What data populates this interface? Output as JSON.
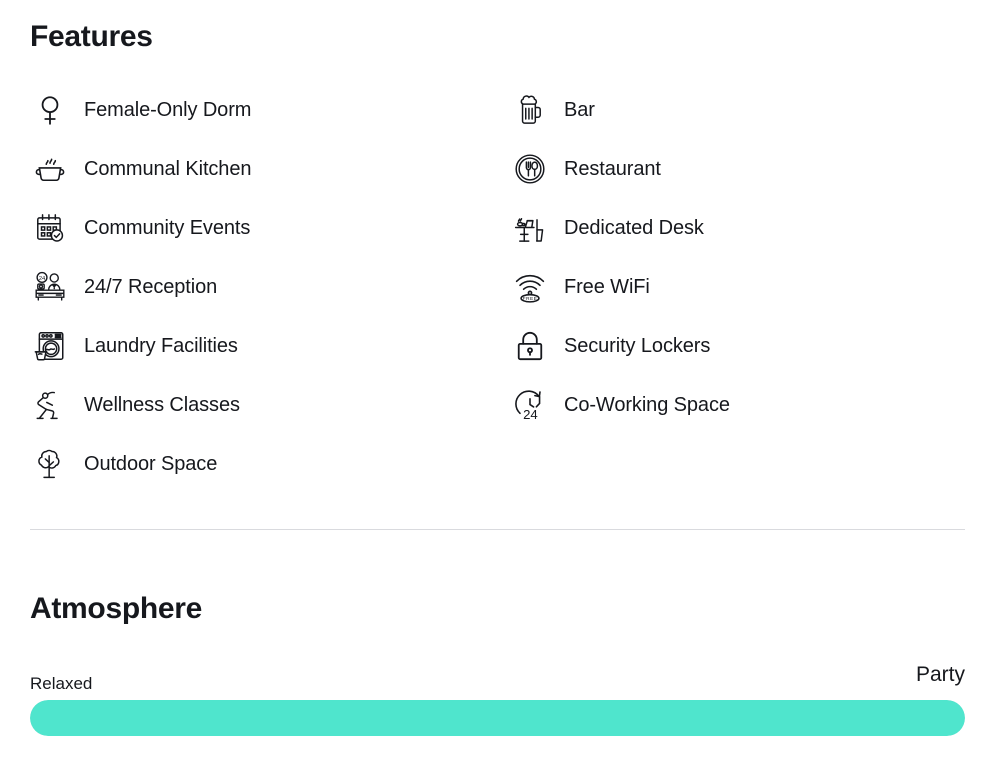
{
  "features": {
    "title": "Features",
    "items": [
      {
        "label": "Female-Only Dorm",
        "icon": "female-symbol-icon",
        "column": "left"
      },
      {
        "label": "Communal Kitchen",
        "icon": "cooking-pot-icon",
        "column": "left"
      },
      {
        "label": "Community Events",
        "icon": "calendar-check-icon",
        "column": "left"
      },
      {
        "label": "24/7 Reception",
        "icon": "reception-desk-icon",
        "column": "left"
      },
      {
        "label": "Laundry Facilities",
        "icon": "washing-machine-icon",
        "column": "left"
      },
      {
        "label": "Wellness Classes",
        "icon": "yoga-pose-icon",
        "column": "left"
      },
      {
        "label": "Outdoor Space",
        "icon": "tree-icon",
        "column": "left"
      },
      {
        "label": "Bar",
        "icon": "beer-mug-icon",
        "column": "right"
      },
      {
        "label": "Restaurant",
        "icon": "plate-cutlery-icon",
        "column": "right"
      },
      {
        "label": "Dedicated Desk",
        "icon": "desk-laptop-icon",
        "column": "right"
      },
      {
        "label": "Free WiFi",
        "icon": "wifi-free-icon",
        "column": "right"
      },
      {
        "label": "Security Lockers",
        "icon": "padlock-icon",
        "column": "right"
      },
      {
        "label": "Co-Working Space",
        "icon": "clock-24-icon",
        "column": "right"
      }
    ]
  },
  "atmosphere": {
    "title": "Atmosphere",
    "scale_min_label": "Relaxed",
    "scale_max_label": "Party",
    "fill_percent": 100,
    "fill_color": "#4fe5cd",
    "track_color": "#e8eaed"
  }
}
